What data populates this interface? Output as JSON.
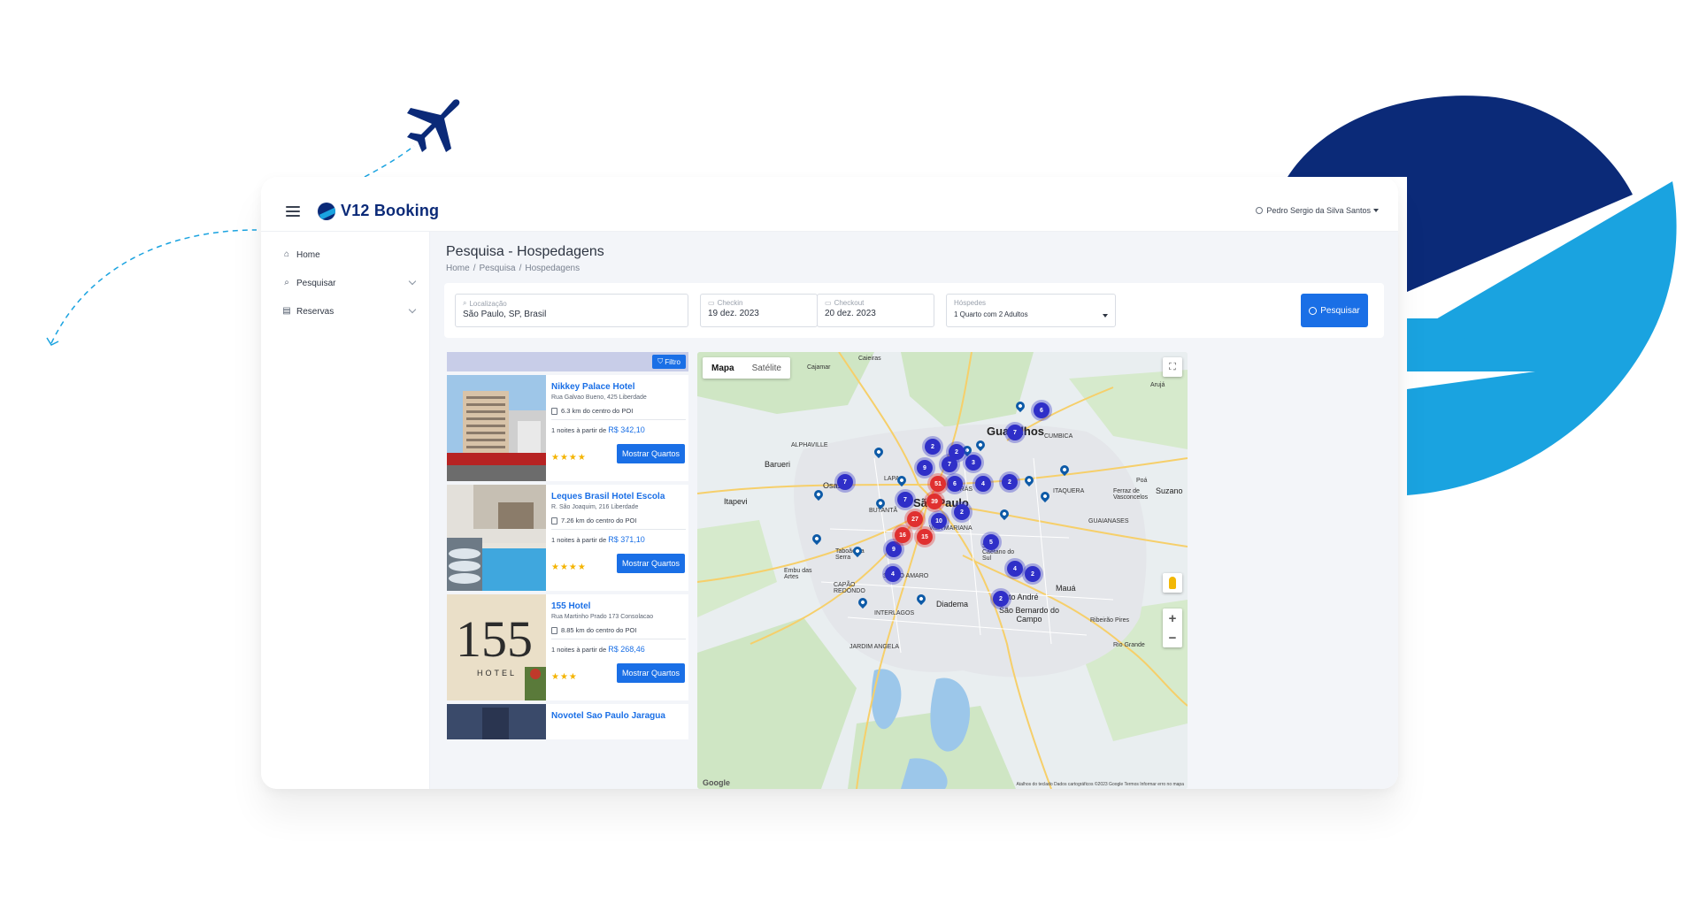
{
  "app": {
    "title": "V12 Booking",
    "user": "Pedro Sergio da Silva Santos",
    "brand_colors": {
      "navy": "#0b2a78",
      "sky": "#1aa3e0",
      "accent": "#1a6fe6"
    }
  },
  "sidebar": {
    "items": [
      {
        "label": "Home",
        "icon": "home-icon"
      },
      {
        "label": "Pesquisar",
        "icon": "search-icon"
      },
      {
        "label": "Reservas",
        "icon": "book-icon"
      }
    ]
  },
  "page": {
    "title": "Pesquisa - Hospedagens",
    "breadcrumb": [
      "Home",
      "Pesquisa",
      "Hospedagens"
    ]
  },
  "search": {
    "location_label": "Localização",
    "location_value": "São Paulo, SP, Brasil",
    "checkin_label": "Checkin",
    "checkin_value": "19 dez. 2023",
    "checkout_label": "Checkout",
    "checkout_value": "20 dez. 2023",
    "guests_label": "Hóspedes",
    "guests_value": "1 Quarto com 2 Adultos",
    "button": "Pesquisar"
  },
  "results": {
    "filter_button": "Filtro",
    "hotels": [
      {
        "name": "Nikkey Palace Hotel",
        "address": "Rua Galvao Bueno, 425 Liberdade",
        "distance": "6.3 km do centro do POI",
        "price_prefix": "1 noites à partir de",
        "price": "R$ 342,10",
        "stars": "★★★★",
        "button": "Mostrar Quartos"
      },
      {
        "name": "Leques Brasil Hotel Escola",
        "address": "R. São Joaquim, 216 Liberdade",
        "distance": "7.26 km do centro do POI",
        "price_prefix": "1 noites à partir de",
        "price": "R$ 371,10",
        "stars": "★★★★",
        "button": "Mostrar Quartos"
      },
      {
        "name": "155 Hotel",
        "address": "Rua Martinho Prado 173 Consolacao",
        "distance": "8.85 km do centro do POI",
        "price_prefix": "1 noites à partir de",
        "price": "R$ 268,46",
        "stars": "★★★",
        "button": "Mostrar Quartos"
      },
      {
        "name": "Novotel Sao Paulo Jaragua"
      }
    ]
  },
  "map": {
    "tabs": [
      "Mapa",
      "Satélite"
    ],
    "labels": {
      "guarulhos": "Guarulhos",
      "sao_paulo": "São Paulo",
      "osasco": "Osasco",
      "barueri": "Barueri",
      "diadema": "Diadema",
      "maua": "Mauá",
      "suzano": "Suzano",
      "santo_andre": "Santo André",
      "sbc": "São Bernardo do Campo",
      "itapevi": "Itapevi",
      "cumbica": "CUMBICA",
      "itaquera": "ITAQUERA",
      "guaianases": "GUAIANASES",
      "alphaville": "ALPHAVILLE",
      "interlagos": "INTERLAGOS",
      "vila_mariana": "VILA MARIANA",
      "santo_amaro": "SANTO AMARO",
      "butanta": "BUTANTÃ",
      "lapa": "LAPA",
      "bras": "BRÁS",
      "taboao": "Taboão da Serra",
      "embu": "Embu das Artes",
      "cajamar": "Cajamar",
      "caieiras": "Caieiras",
      "aruja": "Arujá",
      "poa": "Poá",
      "ferraz": "Ferraz de Vasconcelos",
      "ribeirao": "Ribeirão Pires",
      "rio_grande": "Rio Grande",
      "sao_caetano": "São Caetano do Sul",
      "capao": "CAPÃO REDONDO",
      "jardim_angela": "JARDIM ANGELA"
    },
    "clusters_blue": [
      "6",
      "7",
      "2",
      "2",
      "3",
      "9",
      "7",
      "7",
      "6",
      "4",
      "2",
      "7",
      "2",
      "10",
      "9",
      "5",
      "4",
      "2",
      "4",
      "2"
    ],
    "clusters_red": [
      "51",
      "39",
      "27",
      "16",
      "15"
    ],
    "footer": "Atalhos do teclado   Dados cartográficos ©2023 Google   Termos   Informar erro no mapa",
    "google": "Google"
  }
}
